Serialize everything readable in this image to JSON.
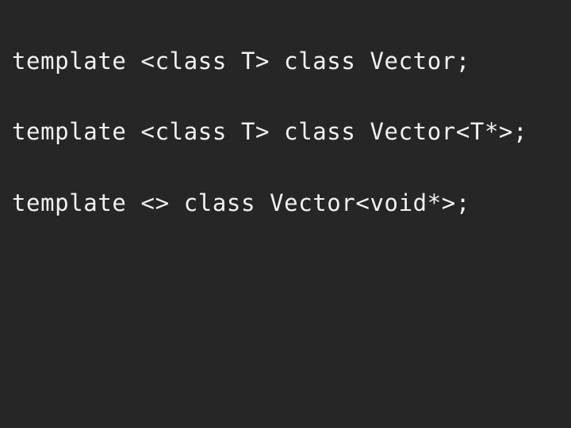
{
  "slide": {
    "background_color": "#262626",
    "text_color": "#f2f2f2",
    "code_lines": [
      "template <class T> class Vector;",
      "template <class T> class Vector<T*>;",
      "template <> class Vector<void*>;"
    ]
  }
}
